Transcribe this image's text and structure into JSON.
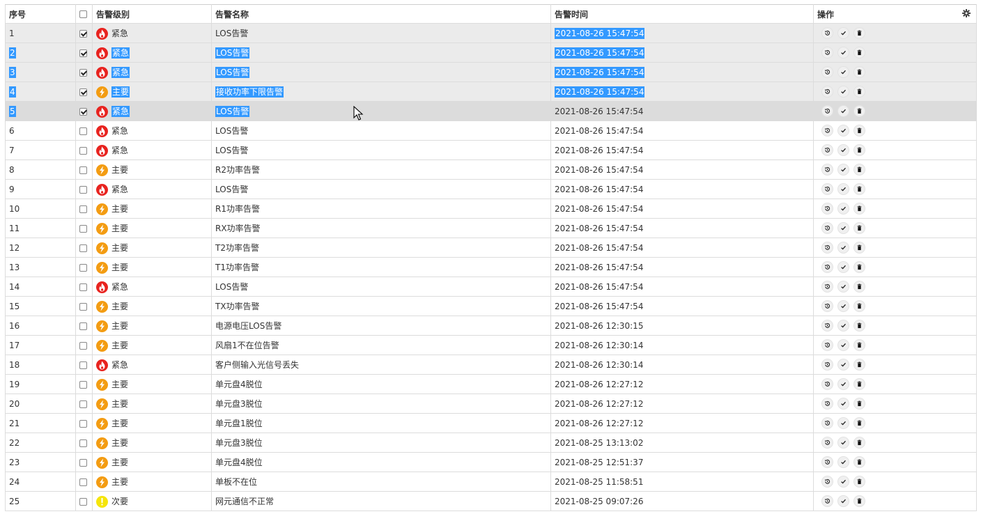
{
  "header": {
    "seq": "序号",
    "level": "告警级别",
    "name": "告警名称",
    "time": "告警时间",
    "ops": "操作"
  },
  "levels": {
    "urgent": {
      "label": "紧急",
      "color": "#e8231f",
      "icon": "fire-icon"
    },
    "major": {
      "label": "主要",
      "color": "#f39c12",
      "icon": "lightning-icon"
    },
    "minor": {
      "label": "次要",
      "color": "#f5e50b",
      "icon": "exclamation-icon"
    }
  },
  "rows": [
    {
      "seq": "1",
      "checked": true,
      "level": "urgent",
      "name": "LOS告警",
      "time": "2021-08-26 15:47:54"
    },
    {
      "seq": "2",
      "checked": true,
      "level": "urgent",
      "name": "LOS告警",
      "time": "2021-08-26 15:47:54"
    },
    {
      "seq": "3",
      "checked": true,
      "level": "urgent",
      "name": "LOS告警",
      "time": "2021-08-26 15:47:54"
    },
    {
      "seq": "4",
      "checked": true,
      "level": "major",
      "name": "接收功率下限告警",
      "time": "2021-08-26 15:47:54"
    },
    {
      "seq": "5",
      "checked": true,
      "level": "urgent",
      "name": "LOS告警",
      "time": "2021-08-26 15:47:54"
    },
    {
      "seq": "6",
      "checked": false,
      "level": "urgent",
      "name": "LOS告警",
      "time": "2021-08-26 15:47:54"
    },
    {
      "seq": "7",
      "checked": false,
      "level": "urgent",
      "name": "LOS告警",
      "time": "2021-08-26 15:47:54"
    },
    {
      "seq": "8",
      "checked": false,
      "level": "major",
      "name": "R2功率告警",
      "time": "2021-08-26 15:47:54"
    },
    {
      "seq": "9",
      "checked": false,
      "level": "urgent",
      "name": "LOS告警",
      "time": "2021-08-26 15:47:54"
    },
    {
      "seq": "10",
      "checked": false,
      "level": "major",
      "name": "R1功率告警",
      "time": "2021-08-26 15:47:54"
    },
    {
      "seq": "11",
      "checked": false,
      "level": "major",
      "name": "RX功率告警",
      "time": "2021-08-26 15:47:54"
    },
    {
      "seq": "12",
      "checked": false,
      "level": "major",
      "name": "T2功率告警",
      "time": "2021-08-26 15:47:54"
    },
    {
      "seq": "13",
      "checked": false,
      "level": "major",
      "name": "T1功率告警",
      "time": "2021-08-26 15:47:54"
    },
    {
      "seq": "14",
      "checked": false,
      "level": "urgent",
      "name": "LOS告警",
      "time": "2021-08-26 15:47:54"
    },
    {
      "seq": "15",
      "checked": false,
      "level": "major",
      "name": "TX功率告警",
      "time": "2021-08-26 15:47:54"
    },
    {
      "seq": "16",
      "checked": false,
      "level": "major",
      "name": "电源电压LOS告警",
      "time": "2021-08-26 12:30:15"
    },
    {
      "seq": "17",
      "checked": false,
      "level": "major",
      "name": "风扇1不在位告警",
      "time": "2021-08-26 12:30:14"
    },
    {
      "seq": "18",
      "checked": false,
      "level": "urgent",
      "name": "客户侧输入光信号丢失",
      "time": "2021-08-26 12:30:14"
    },
    {
      "seq": "19",
      "checked": false,
      "level": "major",
      "name": "单元盘4脱位",
      "time": "2021-08-26 12:27:12"
    },
    {
      "seq": "20",
      "checked": false,
      "level": "major",
      "name": "单元盘3脱位",
      "time": "2021-08-26 12:27:12"
    },
    {
      "seq": "21",
      "checked": false,
      "level": "major",
      "name": "单元盘1脱位",
      "time": "2021-08-26 12:27:12"
    },
    {
      "seq": "22",
      "checked": false,
      "level": "major",
      "name": "单元盘3脱位",
      "time": "2021-08-25 13:13:02"
    },
    {
      "seq": "23",
      "checked": false,
      "level": "major",
      "name": "单元盘4脱位",
      "time": "2021-08-25 12:51:37"
    },
    {
      "seq": "24",
      "checked": false,
      "level": "major",
      "name": "单板不在位",
      "time": "2021-08-25 11:58:51"
    },
    {
      "seq": "25",
      "checked": false,
      "level": "minor",
      "name": "网元通信不正常",
      "time": "2021-08-25 09:07:26"
    }
  ],
  "selection": {
    "seq_from": 2,
    "seq_to": 5,
    "name_from": 2,
    "name_to": 5,
    "time_from": 1,
    "time_to": 4
  },
  "hover_row": 5,
  "colors": {
    "highlight": "#3399ff",
    "selected_row": "#ebebeb",
    "hover_row": "#dcdcdc"
  }
}
